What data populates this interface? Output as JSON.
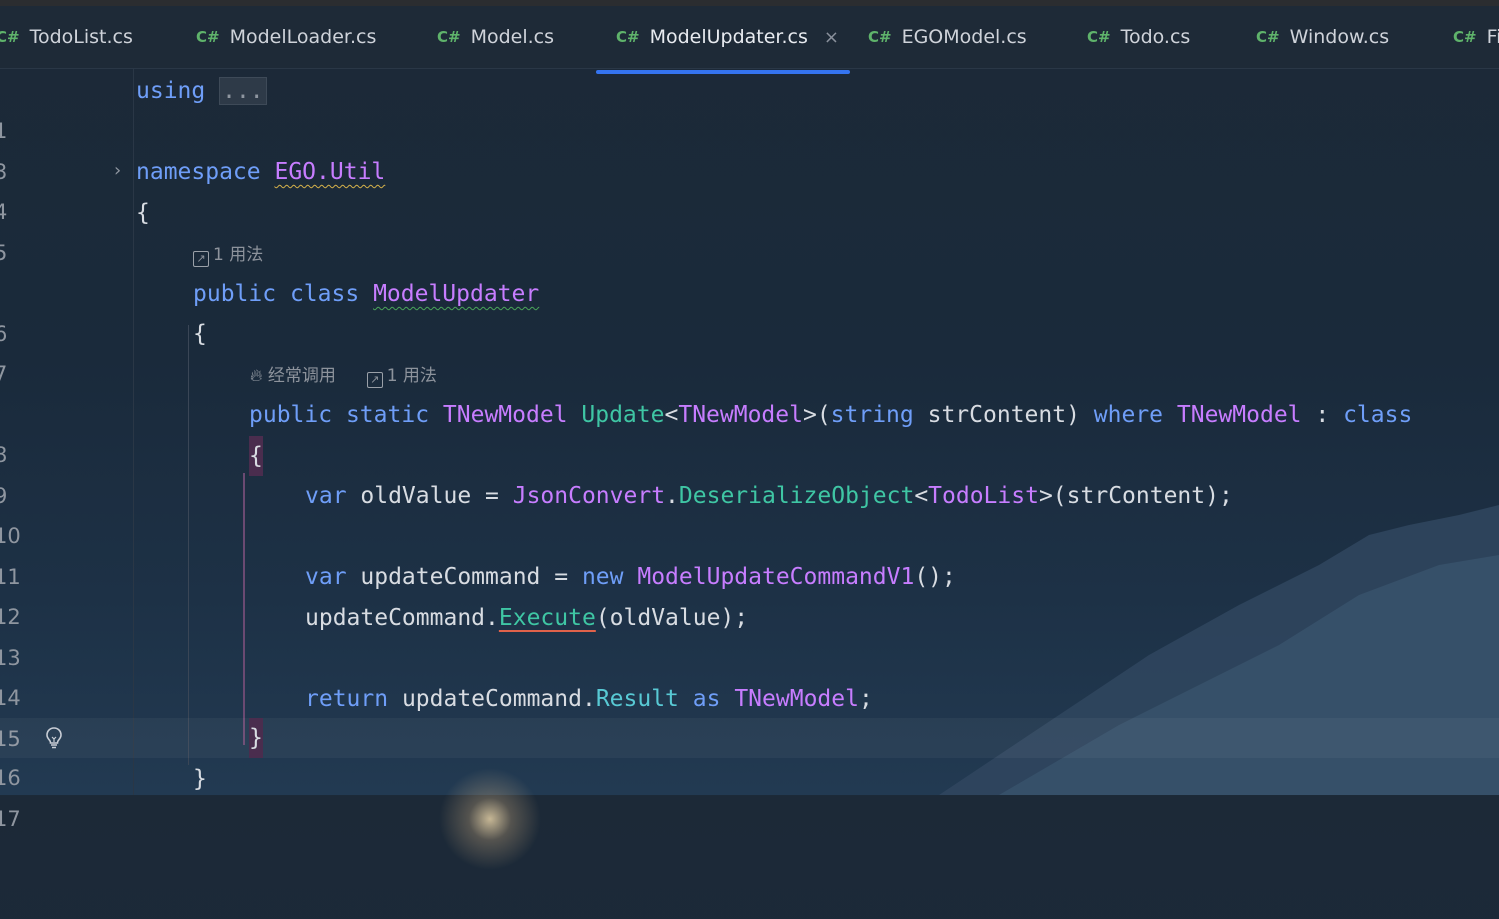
{
  "tabs": [
    {
      "icon": "C#",
      "label": "TodoList.cs"
    },
    {
      "icon": "C#",
      "label": "ModelLoader.cs"
    },
    {
      "icon": "C#",
      "label": "Model.cs"
    },
    {
      "icon": "C#",
      "label": "ModelUpdater.cs",
      "active": true,
      "close": "×"
    },
    {
      "icon": "C#",
      "label": "EGOModel.cs"
    },
    {
      "icon": "C#",
      "label": "Todo.cs"
    },
    {
      "icon": "C#",
      "label": "Window.cs"
    },
    {
      "icon": "C#",
      "label": "Fi"
    }
  ],
  "gutter": {
    "line_numbers": [
      "1",
      "3",
      "4",
      "5",
      "6",
      "7",
      "8",
      "9",
      "10",
      "11",
      "12",
      "13",
      "14",
      "15",
      "16",
      "17"
    ],
    "fold_chevron": "›"
  },
  "hints": {
    "class_usage": "1 用法",
    "method_frequent": "经常调用",
    "method_usage": "1 用法"
  },
  "code": {
    "l1_kw": "using",
    "l1_fold": "...",
    "l4_kw": "namespace",
    "l4_ns": "EGO.Util",
    "l5_brace": "{",
    "l6_kw1": "public",
    "l6_kw2": "class",
    "l6_name": "ModelUpdater",
    "l7_brace": "{",
    "l8_kw1": "public",
    "l8_kw2": "static",
    "l8_ret": "TNewModel",
    "l8_meth": "Update",
    "l8_lt": "<",
    "l8_tparam": "TNewModel",
    "l8_gt": ">(",
    "l8_ptype": "string",
    "l8_pname": " strContent) ",
    "l8_where": "where",
    "l8_wt": "TNewModel",
    "l8_colon": " : ",
    "l8_class": "class",
    "l9_brace": "{",
    "l10_var": "var",
    "l10_name": " oldValue = ",
    "l10_type": "JsonConvert",
    "l10_dot": ".",
    "l10_meth": "DeserializeObject",
    "l10_lt": "<",
    "l10_targ": "TodoList",
    "l10_rest": ">(strContent);",
    "l12_var": "var",
    "l12_name": " updateCommand = ",
    "l12_new": "new",
    "l12_type": "ModelUpdateCommandV1",
    "l12_rest": "();",
    "l13_obj": "updateCommand.",
    "l13_meth": "Execute",
    "l13_rest": "(oldValue);",
    "l15_ret": "return",
    "l15_obj": " updateCommand.",
    "l15_prop": "Result",
    "l15_as": "as",
    "l15_type": "TNewModel",
    "l15_semi": ";",
    "l16_brace": "}",
    "l17_brace": "}"
  },
  "colors": {
    "keyword": "#6f9ef8",
    "type": "#c77dff",
    "method": "#3fc6a4",
    "property": "#58c9d4",
    "active_tab_underline": "#3574f0",
    "csharp_icon": "#5fb36b"
  }
}
